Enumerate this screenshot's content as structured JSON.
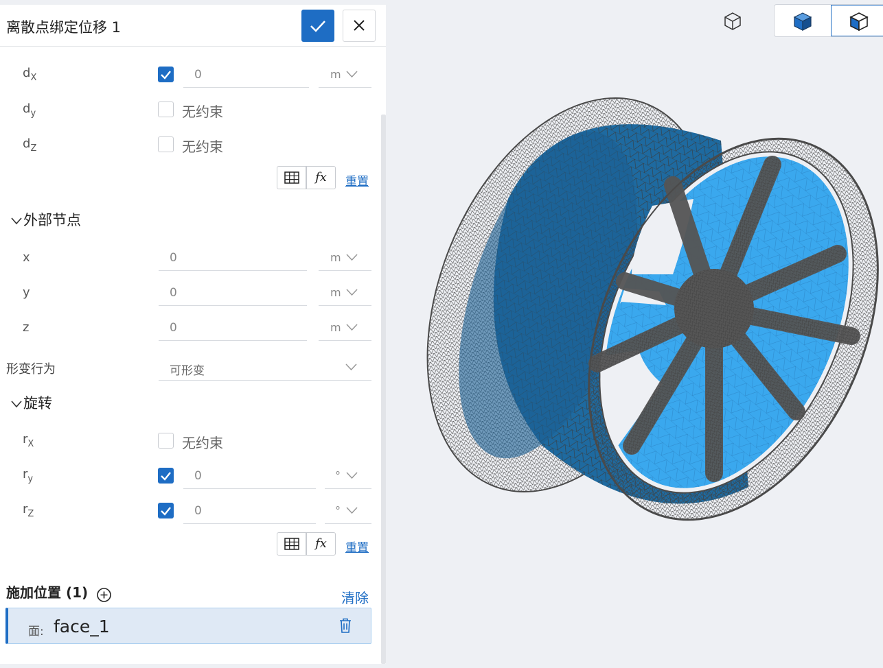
{
  "panel": {
    "title": "离散点绑定位移 1",
    "confirm_icon": "check-icon",
    "close_icon": "close-icon"
  },
  "displacement": {
    "dx": {
      "label": "d",
      "sub": "X",
      "checked": true,
      "value": "0",
      "unit": "m"
    },
    "dy": {
      "label": "d",
      "sub": "y",
      "checked": false,
      "text": "无约束"
    },
    "dz": {
      "label": "d",
      "sub": "Z",
      "checked": false,
      "text": "无约束"
    },
    "reset": "重置"
  },
  "external_node": {
    "title": "外部节点",
    "x": {
      "label": "x",
      "value": "0",
      "unit": "m"
    },
    "y": {
      "label": "y",
      "value": "0",
      "unit": "m"
    },
    "z": {
      "label": "z",
      "value": "0",
      "unit": "m"
    }
  },
  "deform": {
    "label": "形变行为",
    "value": "可形变"
  },
  "rotation": {
    "title": "旋转",
    "rx": {
      "label": "r",
      "sub": "X",
      "checked": false,
      "text": "无约束"
    },
    "ry": {
      "label": "r",
      "sub": "y",
      "checked": true,
      "value": "0",
      "unit": "°"
    },
    "rz": {
      "label": "r",
      "sub": "Z",
      "checked": true,
      "value": "0",
      "unit": "°"
    },
    "reset": "重置"
  },
  "apply": {
    "title": "施加位置 (1)",
    "clear": "清除",
    "items": [
      {
        "prefix": "面:",
        "value": "face_1"
      }
    ]
  },
  "toolbar": {
    "icons": [
      "wireframe-cube-icon",
      "solid-cube-icon",
      "solid-edges-cube-icon"
    ],
    "active": "solid-edges-cube-icon"
  },
  "colors": {
    "accent": "#1e6dc4",
    "mesh_blue": "#1e6aa0",
    "mesh_light": "#3aa8ee",
    "mesh_wire": "#4a4a4a"
  }
}
